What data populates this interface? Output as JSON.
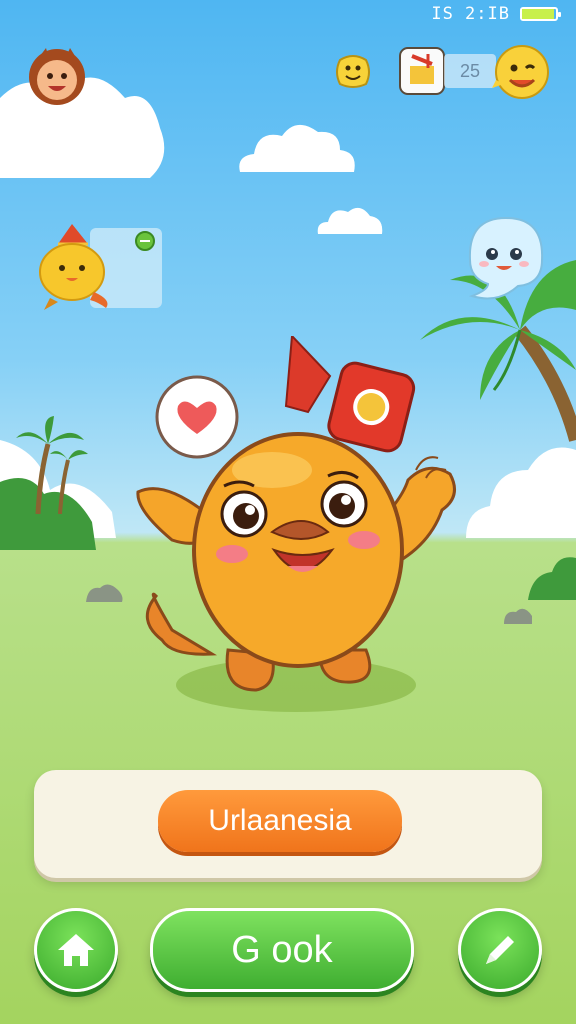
{
  "status_bar": {
    "time": "IS 2:IB",
    "battery_level": 0.95
  },
  "hud": {
    "score": "25"
  },
  "name_button": {
    "label": "Urlaanesia"
  },
  "bottom_bar": {
    "main_button_label": "G ook"
  },
  "colors": {
    "sky": "#4fb6f2",
    "grass": "#a4d45f",
    "accent_orange": "#f0741b",
    "accent_green": "#3fae31"
  }
}
